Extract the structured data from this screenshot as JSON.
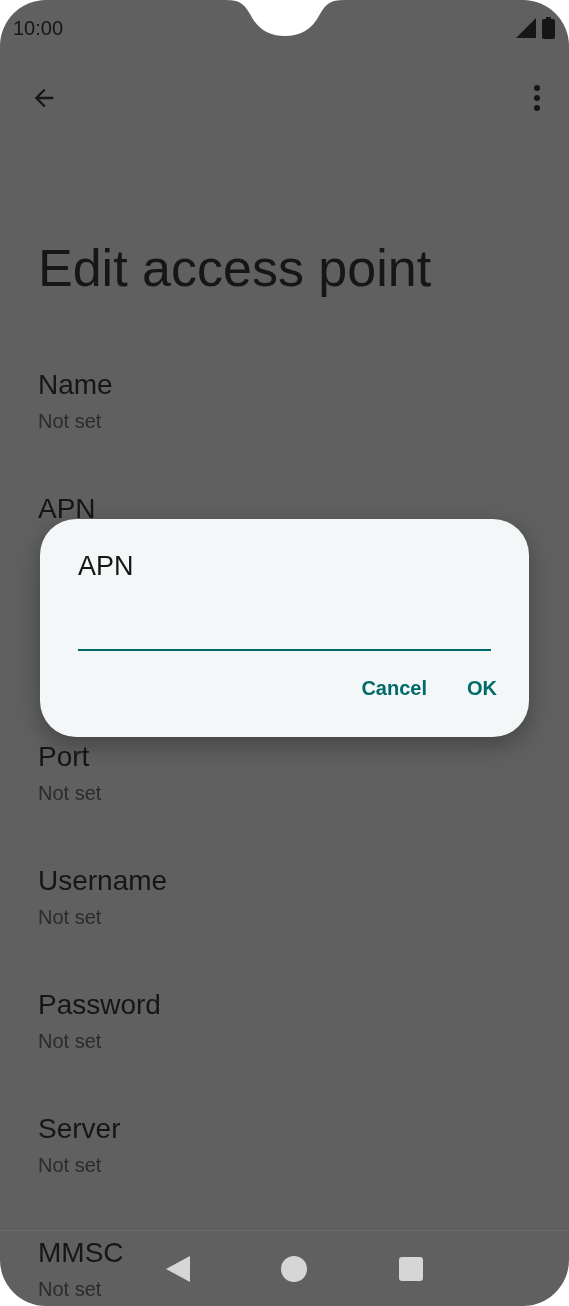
{
  "status_bar": {
    "time": "10:00"
  },
  "title": "Edit access point",
  "settings_top": [
    {
      "label": "Name",
      "value": "Not set"
    },
    {
      "label": "APN"
    }
  ],
  "settings_bottom": [
    {
      "label": "Port",
      "value": "Not set"
    },
    {
      "label": "Username",
      "value": "Not set"
    },
    {
      "label": "Password",
      "value": "Not set"
    },
    {
      "label": "Server",
      "value": "Not set"
    },
    {
      "label": "MMSC",
      "value": "Not set"
    }
  ],
  "dialog": {
    "title": "APN",
    "buttons": [
      "Cancel",
      "OK"
    ]
  }
}
